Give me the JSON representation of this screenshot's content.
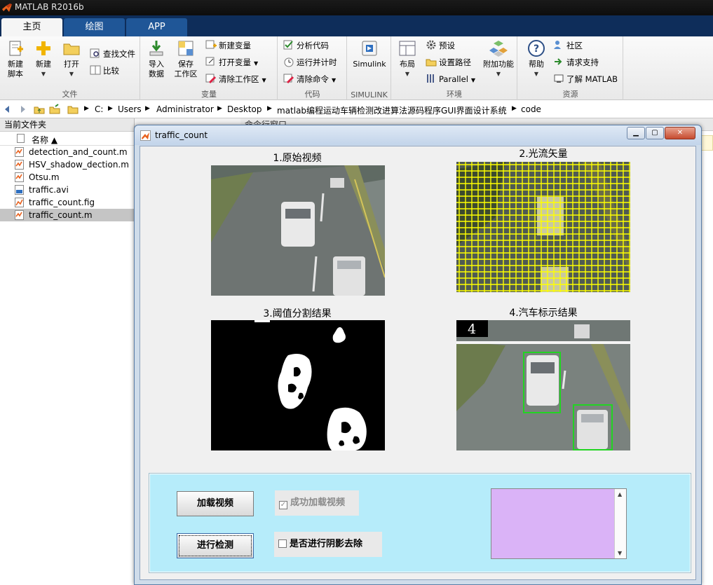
{
  "app": {
    "title": "MATLAB R2016b",
    "tabs": [
      "主页",
      "绘图",
      "APP"
    ],
    "active_tab": "主页"
  },
  "ribbon": {
    "file": {
      "label": "文件",
      "new_script": "新建\n脚本",
      "new": "新建",
      "open": "打开",
      "find_files": "查找文件",
      "compare": "比较"
    },
    "variable": {
      "label": "变量",
      "import": "导入\n数据",
      "save_ws": "保存\n工作区",
      "new_var": "新建变量",
      "open_var": "打开变量",
      "clear_ws": "清除工作区"
    },
    "code": {
      "label": "代码",
      "analyze": "分析代码",
      "run_time": "运行并计时",
      "clear_cmd": "清除命令"
    },
    "simulink": {
      "label": "SIMULINK",
      "button": "Simulink"
    },
    "env": {
      "label": "环境",
      "layout": "布局",
      "preferences": "预设",
      "set_path": "设置路径",
      "parallel": "Parallel",
      "addons": "附加功能"
    },
    "resources": {
      "label": "资源",
      "help": "帮助",
      "community": "社区",
      "support": "请求支持",
      "learn": "了解 MATLAB"
    }
  },
  "address": {
    "crumbs": [
      "C:",
      "Users",
      "Administrator",
      "Desktop",
      "matlab编程运动车辆检测改进算法源码程序GUI界面设计系统",
      "code"
    ]
  },
  "filepanel": {
    "title": "当前文件夹",
    "col_name": "名称 ▲",
    "files": [
      {
        "name": "detection_and_count.m",
        "type": "m"
      },
      {
        "name": "HSV_shadow_dection.m",
        "type": "m"
      },
      {
        "name": "Otsu.m",
        "type": "m"
      },
      {
        "name": "traffic.avi",
        "type": "avi"
      },
      {
        "name": "traffic_count.fig",
        "type": "fig"
      },
      {
        "name": "traffic_count.m",
        "type": "m",
        "selected": true
      }
    ]
  },
  "command_window": {
    "title": "命令行窗口"
  },
  "figure": {
    "title": "traffic_count",
    "axes": [
      {
        "label": "1.原始视频"
      },
      {
        "label": "2.光流矢量"
      },
      {
        "label": "3.阈值分割结果"
      },
      {
        "label": "4.汽车标示结果",
        "count_text": "4"
      }
    ],
    "controls": {
      "load_button": "加载视频",
      "detect_button": "进行检测",
      "loaded_check": "成功加载视频",
      "loaded_checked": true,
      "shadow_check": "是否进行阴影去除",
      "shadow_checked": false,
      "listbox_color": "#dab3f7",
      "panel_color": "#b6ecfa"
    }
  }
}
